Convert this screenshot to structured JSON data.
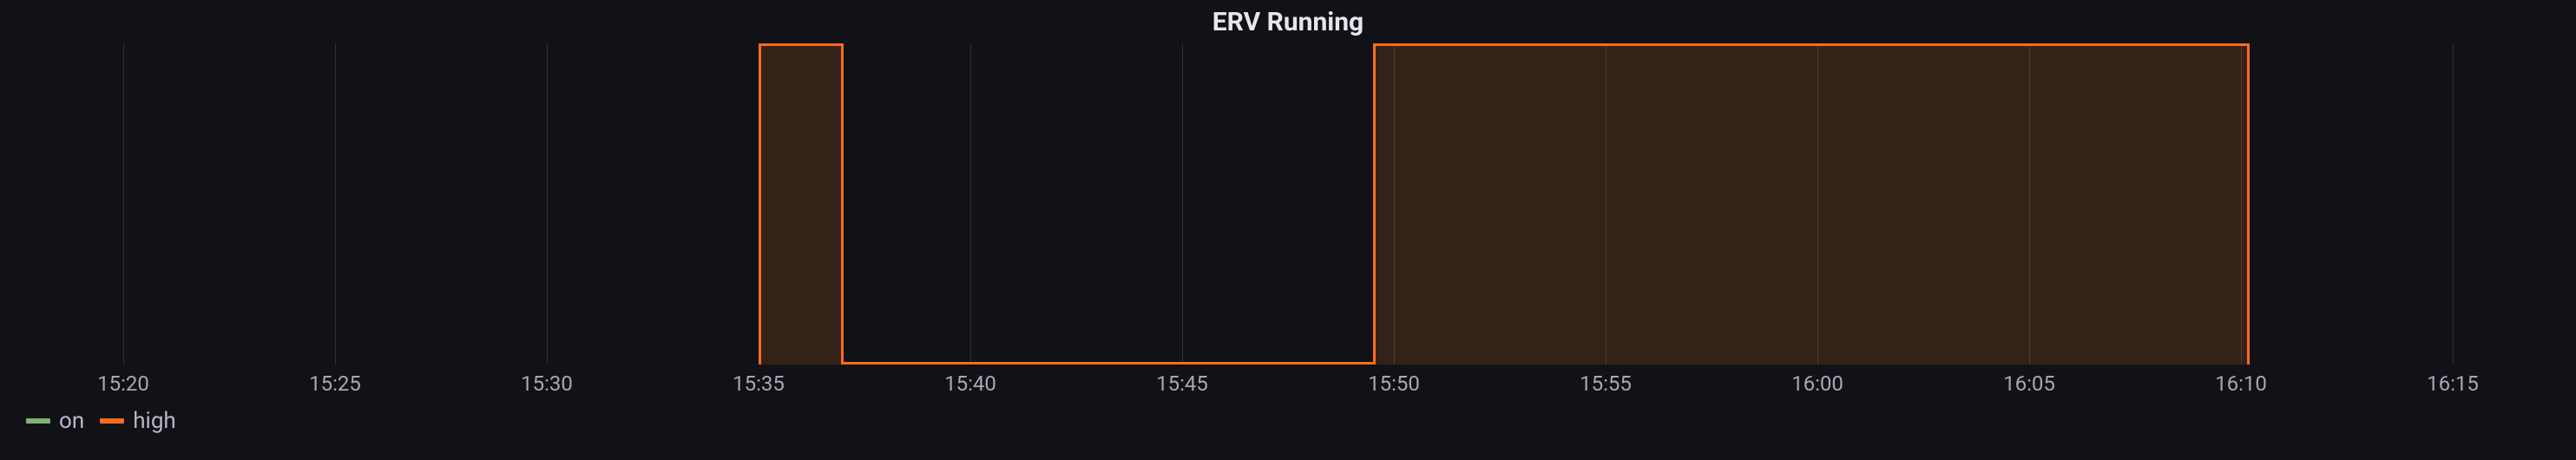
{
  "chart_data": {
    "type": "area",
    "title": "ERV Running",
    "xlabel": "",
    "ylabel": "",
    "x_ticks": [
      "15:20",
      "15:25",
      "15:30",
      "15:35",
      "15:40",
      "15:45",
      "15:50",
      "15:55",
      "16:00",
      "16:05",
      "16:10",
      "16:15"
    ],
    "x_range_minutes": [
      917.5,
      977.5
    ],
    "ylim": [
      0,
      1
    ],
    "series": [
      {
        "name": "on",
        "color": "#7EB26D",
        "points": []
      },
      {
        "name": "high",
        "color": "#ff6b1a",
        "points": [
          {
            "t": "15:35.0",
            "v": 1
          },
          {
            "t": "15:37.0",
            "v": 1
          },
          {
            "t": "15:37.0",
            "v": 0
          },
          {
            "t": "15:49.5",
            "v": 0
          },
          {
            "t": "15:49.5",
            "v": 1
          },
          {
            "t": "16:10.2",
            "v": 1
          },
          {
            "t": "16:10.2",
            "v": 0
          }
        ]
      }
    ],
    "legend_position": "bottom-left",
    "grid": true
  },
  "title": "ERV Running",
  "ticks": {
    "t0": "15:20",
    "t1": "15:25",
    "t2": "15:30",
    "t3": "15:35",
    "t4": "15:40",
    "t5": "15:45",
    "t6": "15:50",
    "t7": "15:55",
    "t8": "16:00",
    "t9": "16:05",
    "t10": "16:10",
    "t11": "16:15"
  },
  "legend": {
    "on": {
      "label": "on",
      "color": "#7EB26D"
    },
    "high": {
      "label": "high",
      "color": "#ff6b1a"
    }
  }
}
